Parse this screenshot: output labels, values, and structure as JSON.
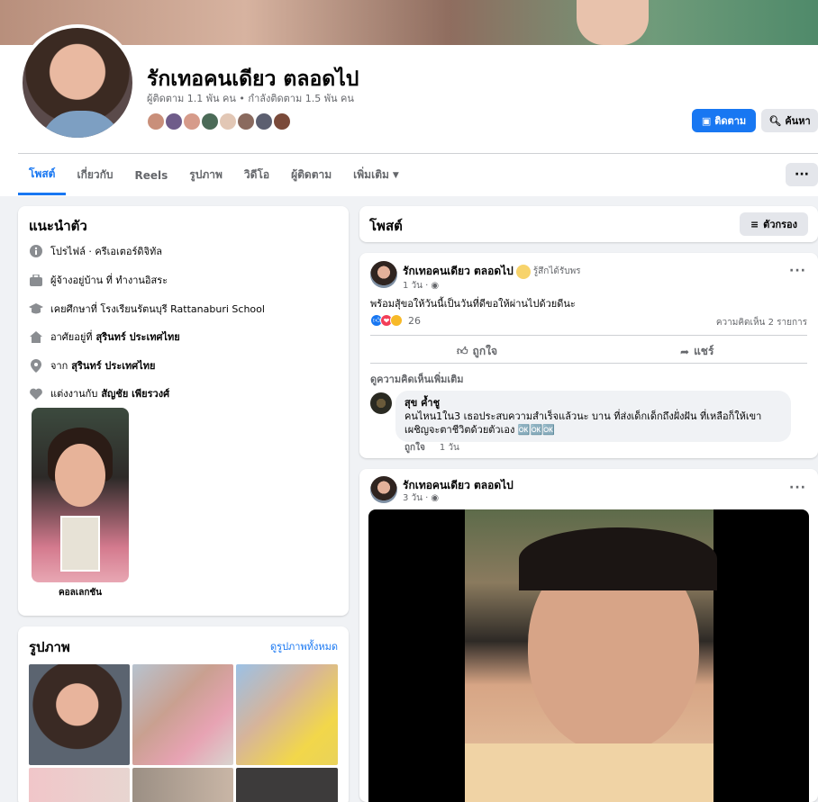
{
  "profile": {
    "name": "รักเทอคนเดียว ตลอดไป",
    "stats": "ผู้ติดตาม 1.1 พัน คน • กำลังติดตาม 1.5 พัน คน",
    "friend_colors": [
      "#c98f7a",
      "#6f5c8a",
      "#d69b8a",
      "#4b6b58",
      "#e2c7b5",
      "#8a6a5e",
      "#5c5f70",
      "#7a4a3a"
    ],
    "follow_label": "ติดตาม",
    "search_label": "ค้นหา"
  },
  "tabs": [
    {
      "label": "โพสต์"
    },
    {
      "label": "เกี่ยวกับ"
    },
    {
      "label": "Reels"
    },
    {
      "label": "รูปภาพ"
    },
    {
      "label": "วิดีโอ"
    },
    {
      "label": "ผู้ติดตาม"
    },
    {
      "label": "เพิ่มเติม"
    }
  ],
  "more_button": "···",
  "intro": {
    "title": "แนะนำตัว",
    "rows": [
      {
        "icon": "info-icon",
        "text": "โปรไฟล์ · ครีเอเตอร์ดิจิทัล",
        "strong": ""
      },
      {
        "icon": "briefcase-icon",
        "text": "ผู้จ้างอยู่บ้าน ที่ ทำงานอิสระ",
        "strong": ""
      },
      {
        "icon": "graduation-cap-icon",
        "text": "เคยศึกษาที่ โรงเรียนรัตนบุรี Rattanaburi School",
        "strong": ""
      },
      {
        "icon": "home-icon",
        "text": "อาศัยอยู่ที่",
        "strong": "สุรินทร์ ประเทศไทย"
      },
      {
        "icon": "location-pin-icon",
        "text": "จาก",
        "strong": "สุรินทร์ ประเทศไทย"
      },
      {
        "icon": "heart-icon",
        "text": "แต่งงานกับ",
        "strong": "สัญชัย เพียรวงศ์"
      }
    ],
    "featured_label": "คอลเลกชัน"
  },
  "photos": {
    "title": "รูปภาพ",
    "see_all": "ดูรูปภาพทั้งหมด"
  },
  "posts_header": {
    "title": "โพสต์",
    "filter_label": "ตัวกรอง"
  },
  "post1": {
    "author": "รักเทอคนเดียว ตลอดไป",
    "feeling": "รู้สึกได้รับพร",
    "time": "1 วัน ·",
    "text": "พร้อมสุ้ขอให้วันนี้เป็นวันที่ดีขอให้ผ่านไปด้วยดีนะ",
    "reaction_count": "26",
    "comments_count": "ความคิดเห็น 2 รายการ",
    "like_label": "ถูกใจ",
    "share_label": "แชร์",
    "more_comments": "ดูความคิดเห็นเพิ่มเติม",
    "comment": {
      "author": "สุข ค้ำชู",
      "text": "คนไหน1ใน3 เธอประสบความสำเร็จแล้วนะ บาน ที่ส่งเด็กเด็กถึงฝั่งฝัน ที่เหลือก็ให้เขาเผชิญจะตาชีวิตด้วยตัวเอง 🆗🆗🆗",
      "like": "ถูกใจ",
      "time": "1 วัน"
    }
  },
  "post2": {
    "author": "รักเทอคนเดียว ตลอดไป",
    "time": "3 วัน ·"
  }
}
